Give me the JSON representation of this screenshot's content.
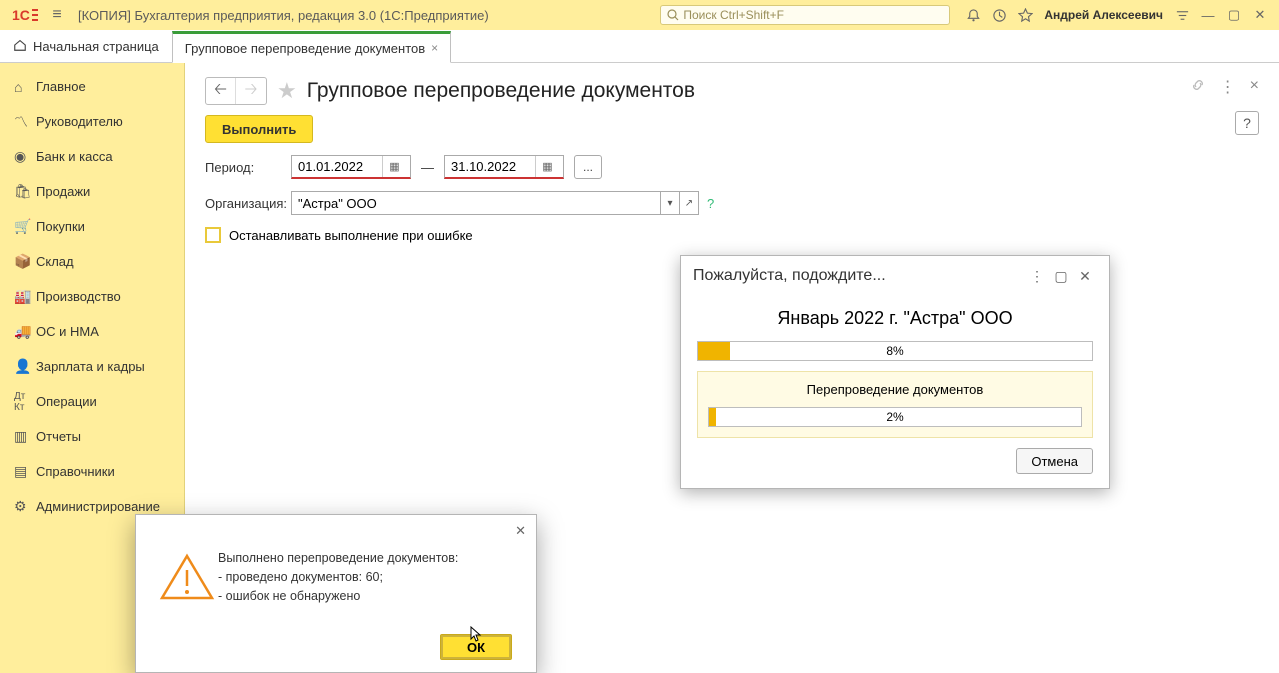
{
  "titlebar": {
    "app_title": "[КОПИЯ] Бухгалтерия предприятия, редакция 3.0  (1С:Предприятие)",
    "search_placeholder": "Поиск Ctrl+Shift+F",
    "user": "Андрей Алексеевич"
  },
  "tabs": {
    "home": "Начальная страница",
    "active": "Групповое перепроведение документов"
  },
  "sidebar": {
    "items": [
      {
        "label": "Главное"
      },
      {
        "label": "Руководителю"
      },
      {
        "label": "Банк и касса"
      },
      {
        "label": "Продажи"
      },
      {
        "label": "Покупки"
      },
      {
        "label": "Склад"
      },
      {
        "label": "Производство"
      },
      {
        "label": "ОС и НМА"
      },
      {
        "label": "Зарплата и кадры"
      },
      {
        "label": "Операции"
      },
      {
        "label": "Отчеты"
      },
      {
        "label": "Справочники"
      },
      {
        "label": "Администрирование"
      }
    ]
  },
  "page": {
    "title": "Групповое перепроведение документов",
    "execute": "Выполнить",
    "help": "?",
    "period_label": "Период:",
    "date_from": "01.01.2022",
    "date_to": "31.10.2022",
    "dash": "—",
    "dots": "...",
    "org_label": "Организация:",
    "org_value": "\"Астра\" ООО",
    "checkbox_label": "Останавливать выполнение при ошибке",
    "q": "?"
  },
  "progress": {
    "title": "Пожалуйста, подождите...",
    "subtitle": "Январь 2022 г. \"Астра\" ООО",
    "outer_pct": "8%",
    "outer_fill": "8%",
    "status": "Перепроведение документов",
    "inner_pct": "2%",
    "inner_fill": "2%",
    "cancel": "Отмена"
  },
  "alert": {
    "line1": "Выполнено перепроведение документов:",
    "line2": "- проведено документов: 60;",
    "line3": "- ошибок не обнаружено",
    "ok": "ОК"
  }
}
